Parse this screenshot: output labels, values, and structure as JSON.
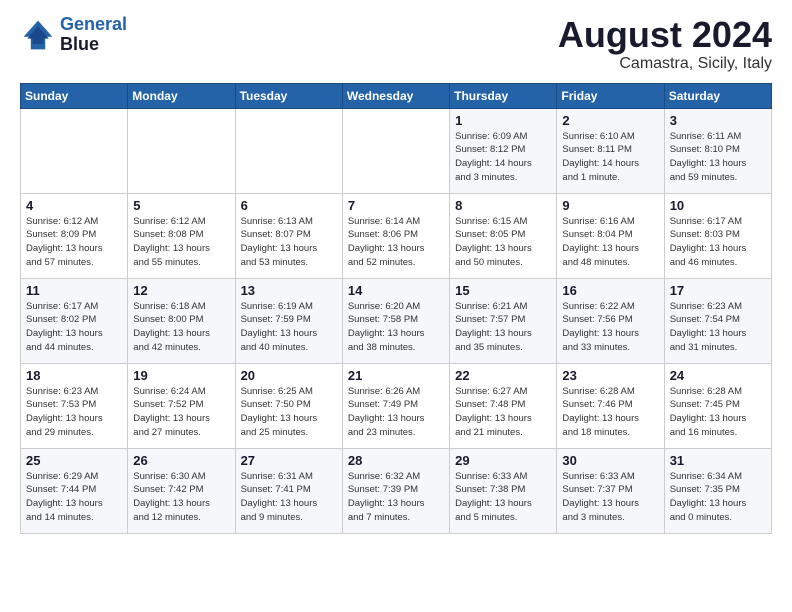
{
  "header": {
    "logo_line1": "General",
    "logo_line2": "Blue",
    "month_year": "August 2024",
    "location": "Camastra, Sicily, Italy"
  },
  "days_of_week": [
    "Sunday",
    "Monday",
    "Tuesday",
    "Wednesday",
    "Thursday",
    "Friday",
    "Saturday"
  ],
  "weeks": [
    [
      {
        "day": "",
        "info": ""
      },
      {
        "day": "",
        "info": ""
      },
      {
        "day": "",
        "info": ""
      },
      {
        "day": "",
        "info": ""
      },
      {
        "day": "1",
        "info": "Sunrise: 6:09 AM\nSunset: 8:12 PM\nDaylight: 14 hours\nand 3 minutes."
      },
      {
        "day": "2",
        "info": "Sunrise: 6:10 AM\nSunset: 8:11 PM\nDaylight: 14 hours\nand 1 minute."
      },
      {
        "day": "3",
        "info": "Sunrise: 6:11 AM\nSunset: 8:10 PM\nDaylight: 13 hours\nand 59 minutes."
      }
    ],
    [
      {
        "day": "4",
        "info": "Sunrise: 6:12 AM\nSunset: 8:09 PM\nDaylight: 13 hours\nand 57 minutes."
      },
      {
        "day": "5",
        "info": "Sunrise: 6:12 AM\nSunset: 8:08 PM\nDaylight: 13 hours\nand 55 minutes."
      },
      {
        "day": "6",
        "info": "Sunrise: 6:13 AM\nSunset: 8:07 PM\nDaylight: 13 hours\nand 53 minutes."
      },
      {
        "day": "7",
        "info": "Sunrise: 6:14 AM\nSunset: 8:06 PM\nDaylight: 13 hours\nand 52 minutes."
      },
      {
        "day": "8",
        "info": "Sunrise: 6:15 AM\nSunset: 8:05 PM\nDaylight: 13 hours\nand 50 minutes."
      },
      {
        "day": "9",
        "info": "Sunrise: 6:16 AM\nSunset: 8:04 PM\nDaylight: 13 hours\nand 48 minutes."
      },
      {
        "day": "10",
        "info": "Sunrise: 6:17 AM\nSunset: 8:03 PM\nDaylight: 13 hours\nand 46 minutes."
      }
    ],
    [
      {
        "day": "11",
        "info": "Sunrise: 6:17 AM\nSunset: 8:02 PM\nDaylight: 13 hours\nand 44 minutes."
      },
      {
        "day": "12",
        "info": "Sunrise: 6:18 AM\nSunset: 8:00 PM\nDaylight: 13 hours\nand 42 minutes."
      },
      {
        "day": "13",
        "info": "Sunrise: 6:19 AM\nSunset: 7:59 PM\nDaylight: 13 hours\nand 40 minutes."
      },
      {
        "day": "14",
        "info": "Sunrise: 6:20 AM\nSunset: 7:58 PM\nDaylight: 13 hours\nand 38 minutes."
      },
      {
        "day": "15",
        "info": "Sunrise: 6:21 AM\nSunset: 7:57 PM\nDaylight: 13 hours\nand 35 minutes."
      },
      {
        "day": "16",
        "info": "Sunrise: 6:22 AM\nSunset: 7:56 PM\nDaylight: 13 hours\nand 33 minutes."
      },
      {
        "day": "17",
        "info": "Sunrise: 6:23 AM\nSunset: 7:54 PM\nDaylight: 13 hours\nand 31 minutes."
      }
    ],
    [
      {
        "day": "18",
        "info": "Sunrise: 6:23 AM\nSunset: 7:53 PM\nDaylight: 13 hours\nand 29 minutes."
      },
      {
        "day": "19",
        "info": "Sunrise: 6:24 AM\nSunset: 7:52 PM\nDaylight: 13 hours\nand 27 minutes."
      },
      {
        "day": "20",
        "info": "Sunrise: 6:25 AM\nSunset: 7:50 PM\nDaylight: 13 hours\nand 25 minutes."
      },
      {
        "day": "21",
        "info": "Sunrise: 6:26 AM\nSunset: 7:49 PM\nDaylight: 13 hours\nand 23 minutes."
      },
      {
        "day": "22",
        "info": "Sunrise: 6:27 AM\nSunset: 7:48 PM\nDaylight: 13 hours\nand 21 minutes."
      },
      {
        "day": "23",
        "info": "Sunrise: 6:28 AM\nSunset: 7:46 PM\nDaylight: 13 hours\nand 18 minutes."
      },
      {
        "day": "24",
        "info": "Sunrise: 6:28 AM\nSunset: 7:45 PM\nDaylight: 13 hours\nand 16 minutes."
      }
    ],
    [
      {
        "day": "25",
        "info": "Sunrise: 6:29 AM\nSunset: 7:44 PM\nDaylight: 13 hours\nand 14 minutes."
      },
      {
        "day": "26",
        "info": "Sunrise: 6:30 AM\nSunset: 7:42 PM\nDaylight: 13 hours\nand 12 minutes."
      },
      {
        "day": "27",
        "info": "Sunrise: 6:31 AM\nSunset: 7:41 PM\nDaylight: 13 hours\nand 9 minutes."
      },
      {
        "day": "28",
        "info": "Sunrise: 6:32 AM\nSunset: 7:39 PM\nDaylight: 13 hours\nand 7 minutes."
      },
      {
        "day": "29",
        "info": "Sunrise: 6:33 AM\nSunset: 7:38 PM\nDaylight: 13 hours\nand 5 minutes."
      },
      {
        "day": "30",
        "info": "Sunrise: 6:33 AM\nSunset: 7:37 PM\nDaylight: 13 hours\nand 3 minutes."
      },
      {
        "day": "31",
        "info": "Sunrise: 6:34 AM\nSunset: 7:35 PM\nDaylight: 13 hours\nand 0 minutes."
      }
    ]
  ]
}
